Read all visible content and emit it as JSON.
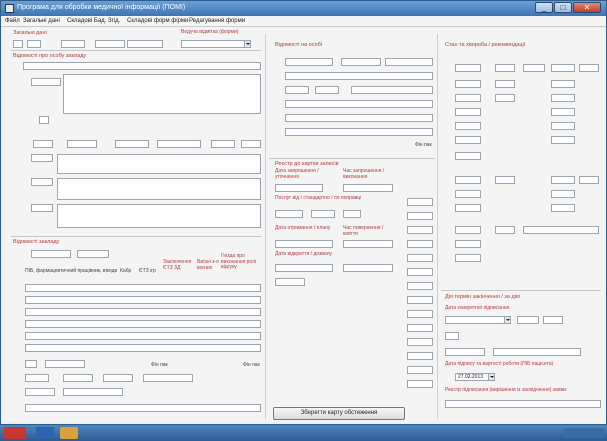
{
  "window": {
    "title": "Програма для обробки медичної інформації (ПОМІ)",
    "controls": {
      "minimize": "_",
      "maximize": "□",
      "close": "✕"
    }
  },
  "menu": {
    "items": [
      "Файл",
      "Загальні дані",
      "Складові Бад. Згід.",
      "Складові форм фірми",
      "Редагування форми"
    ]
  },
  "left": {
    "section1": {
      "title": "Загальні дані",
      "label_right": "Ведуча відмітка (форми)"
    },
    "section2": {
      "title": "Відомості про особу закладу"
    },
    "section3": {
      "title": "Відомості закладу",
      "header_cols": [
        "ПІБ, фармацевтичний працівник, вікоди",
        "Кабр",
        "ЄТЗ ігр",
        "Заключення ЄТЗ ЗД",
        "Виїзні з-о вогних",
        "Гнізда про виконання ролі відгуку"
      ],
      "footer_label_a": "Фін пак",
      "footer_label_b": "Фін пак"
    }
  },
  "middle": {
    "section1": {
      "title": "Відомості на особі",
      "status": "Фін пак"
    },
    "section2": {
      "title": "Реєстр до картки записів",
      "labels": [
        "Дата запрошення / уточнення",
        "Час запрошення / виконання",
        "Послуг від / стандартно / по поправці",
        "Дата отримання / плану",
        "Час повернення / взяття",
        "Дата відкриття / дозволу"
      ]
    }
  },
  "right": {
    "section1": {
      "title": "Стан та хвороба / рекомендації"
    },
    "section2": {
      "title": "Дія термін закінчення / за дію",
      "labels": [
        "Дата конкретної підписання",
        "Дата підпису та вартості роботи (ПІБ пацієнта)",
        "Реєстр підписання (вирішення із засвідчення) заяви"
      ],
      "date_value": "27.02.2013"
    }
  },
  "bottom_button": {
    "label": "Зберегти карту обстеження"
  },
  "taskbar": {
    "items": [
      "start",
      "word-icon",
      "paint-icon"
    ]
  }
}
